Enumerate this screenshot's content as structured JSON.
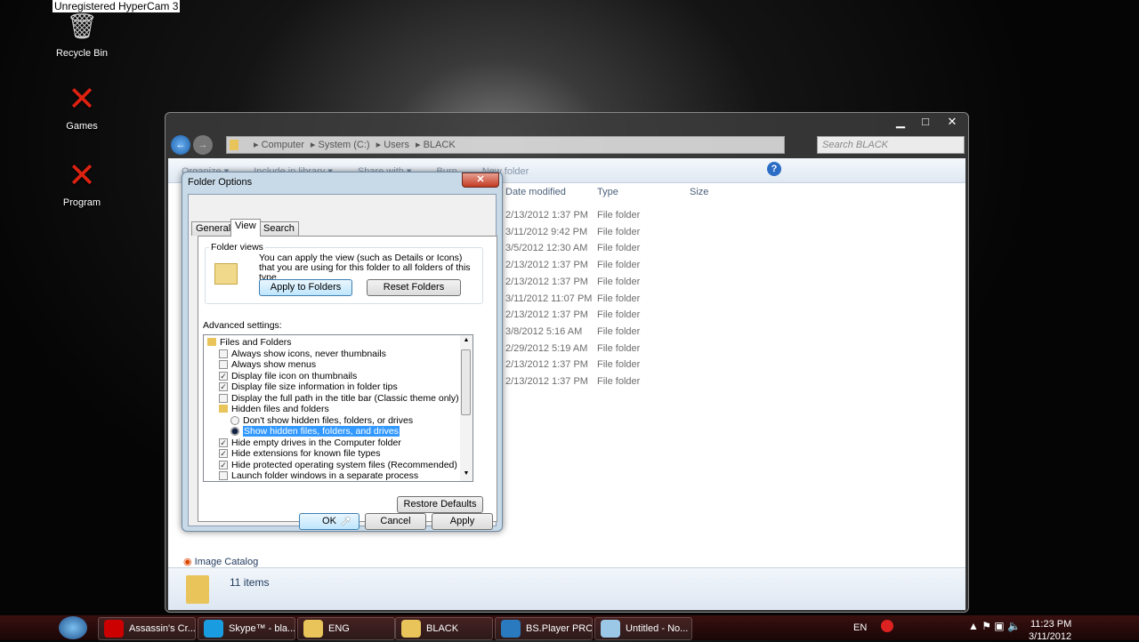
{
  "watermark": "Unregistered HyperCam 3",
  "desktop": [
    {
      "label": "Recycle Bin",
      "icon": "recycle-bin-icon"
    },
    {
      "label": "Games",
      "icon": "red-x-icon"
    },
    {
      "label": "Program",
      "icon": "red-x-icon"
    }
  ],
  "explorer": {
    "breadcrumb": [
      "Computer",
      "System (C:)",
      "Users",
      "BLACK"
    ],
    "search_placeholder": "Search BLACK",
    "toolbar": [
      "Organize ▾",
      "Include in library ▾",
      "Share with ▾",
      "Burn",
      "New folder"
    ],
    "columns": [
      "Date modified",
      "Type",
      "Size"
    ],
    "files": [
      {
        "date": "2/13/2012 1:37 PM",
        "type": "File folder"
      },
      {
        "date": "3/11/2012 9:42 PM",
        "type": "File folder"
      },
      {
        "date": "3/5/2012 12:30 AM",
        "type": "File folder"
      },
      {
        "date": "2/13/2012 1:37 PM",
        "type": "File folder"
      },
      {
        "date": "2/13/2012 1:37 PM",
        "type": "File folder"
      },
      {
        "date": "3/11/2012 11:07 PM",
        "type": "File folder"
      },
      {
        "date": "2/13/2012 1:37 PM",
        "type": "File folder"
      },
      {
        "date": "3/8/2012 5:16 AM",
        "type": "File folder"
      },
      {
        "date": "2/29/2012 5:19 AM",
        "type": "File folder"
      },
      {
        "date": "2/13/2012 1:37 PM",
        "type": "File folder"
      },
      {
        "date": "2/13/2012 1:37 PM",
        "type": "File folder"
      }
    ],
    "nav_item": "Image Catalog",
    "status": "11 items"
  },
  "dialog": {
    "title": "Folder Options",
    "tabs": [
      "General",
      "View",
      "Search"
    ],
    "active_tab": "View",
    "folder_views_label": "Folder views",
    "folder_views_text": "You can apply the view (such as Details or Icons) that you are using for this folder to all folders of this type.",
    "apply_to_folders": "Apply to Folders",
    "reset_folders": "Reset Folders",
    "advanced_label": "Advanced settings:",
    "advanced": [
      {
        "kind": "folder",
        "label": "Files and Folders",
        "indent": 0
      },
      {
        "kind": "check",
        "label": "Always show icons, never thumbnails",
        "checked": false,
        "indent": 1
      },
      {
        "kind": "check",
        "label": "Always show menus",
        "checked": false,
        "indent": 1
      },
      {
        "kind": "check",
        "label": "Display file icon on thumbnails",
        "checked": true,
        "indent": 1
      },
      {
        "kind": "check",
        "label": "Display file size information in folder tips",
        "checked": true,
        "indent": 1
      },
      {
        "kind": "check",
        "label": "Display the full path in the title bar (Classic theme only)",
        "checked": false,
        "indent": 1
      },
      {
        "kind": "folder",
        "label": "Hidden files and folders",
        "indent": 1
      },
      {
        "kind": "radio",
        "label": "Don't show hidden files, folders, or drives",
        "checked": false,
        "indent": 2
      },
      {
        "kind": "radio",
        "label": "Show hidden files, folders, and drives",
        "checked": true,
        "selected": true,
        "indent": 2
      },
      {
        "kind": "check",
        "label": "Hide empty drives in the Computer folder",
        "checked": true,
        "indent": 1
      },
      {
        "kind": "check",
        "label": "Hide extensions for known file types",
        "checked": true,
        "indent": 1
      },
      {
        "kind": "check",
        "label": "Hide protected operating system files (Recommended)",
        "checked": true,
        "indent": 1
      },
      {
        "kind": "check",
        "label": "Launch folder windows in a separate process",
        "checked": false,
        "indent": 1
      }
    ],
    "restore_defaults": "Restore Defaults",
    "ok": "OK",
    "cancel": "Cancel",
    "apply": "Apply"
  },
  "taskbar": {
    "items": [
      {
        "label": "Assassin's Cr...",
        "icon": "opera-icon",
        "color": "#c00"
      },
      {
        "label": "Skype™ - bla...",
        "icon": "skype-icon",
        "color": "#1a9de0"
      },
      {
        "label": "ENG",
        "icon": "folder-icon",
        "color": "#e8c45b"
      },
      {
        "label": "BLACK",
        "icon": "folder-icon",
        "color": "#e8c45b"
      },
      {
        "label": "BS.Player PRO",
        "icon": "bsplayer-icon",
        "color": "#2a7ac0"
      },
      {
        "label": "Untitled - No...",
        "icon": "notepad-icon",
        "color": "#9cc8e8"
      }
    ],
    "lang": "EN",
    "time": "11:23 PM",
    "date": "3/11/2012"
  }
}
